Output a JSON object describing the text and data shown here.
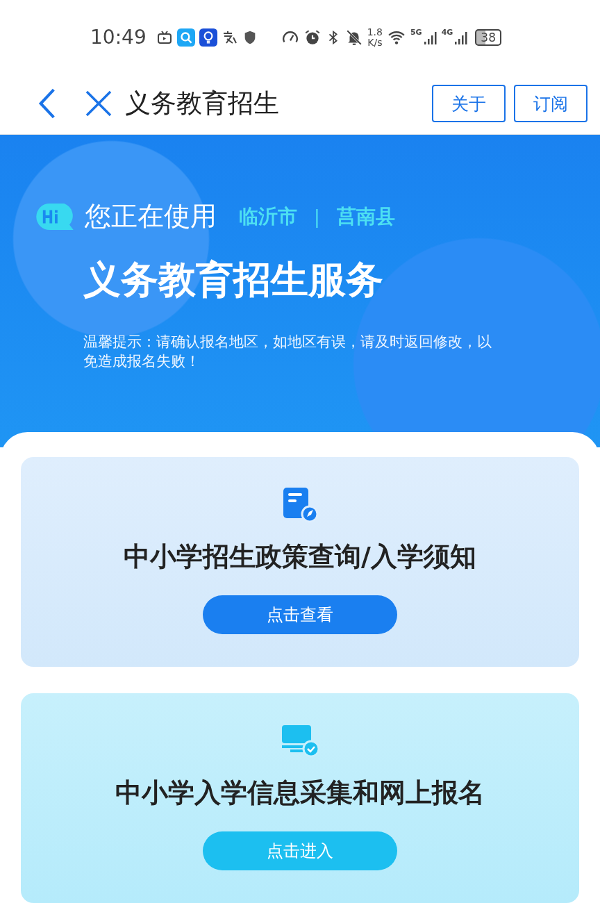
{
  "status_bar": {
    "time": "10:49",
    "speed_value": "1.8",
    "speed_unit": "K/s",
    "network_1": "5G",
    "network_2": "4G",
    "battery": "38"
  },
  "header": {
    "title": "义务教育招生",
    "buttons": [
      "关于",
      "订阅"
    ]
  },
  "hero": {
    "using_label": "您正在使用",
    "city": "临沂市",
    "separator": "|",
    "county": "莒南县",
    "title": "义务教育招生服务",
    "notice": "温馨提示：请确认报名地区，如地区有误，请及时返回修改，以免造成报名失败！"
  },
  "cards": [
    {
      "kind": "policy",
      "title": "中小学招生政策查询/入学须知",
      "button": "点击查看"
    },
    {
      "kind": "apply",
      "title": "中小学入学信息采集和网上报名",
      "button": "点击进入"
    }
  ]
}
